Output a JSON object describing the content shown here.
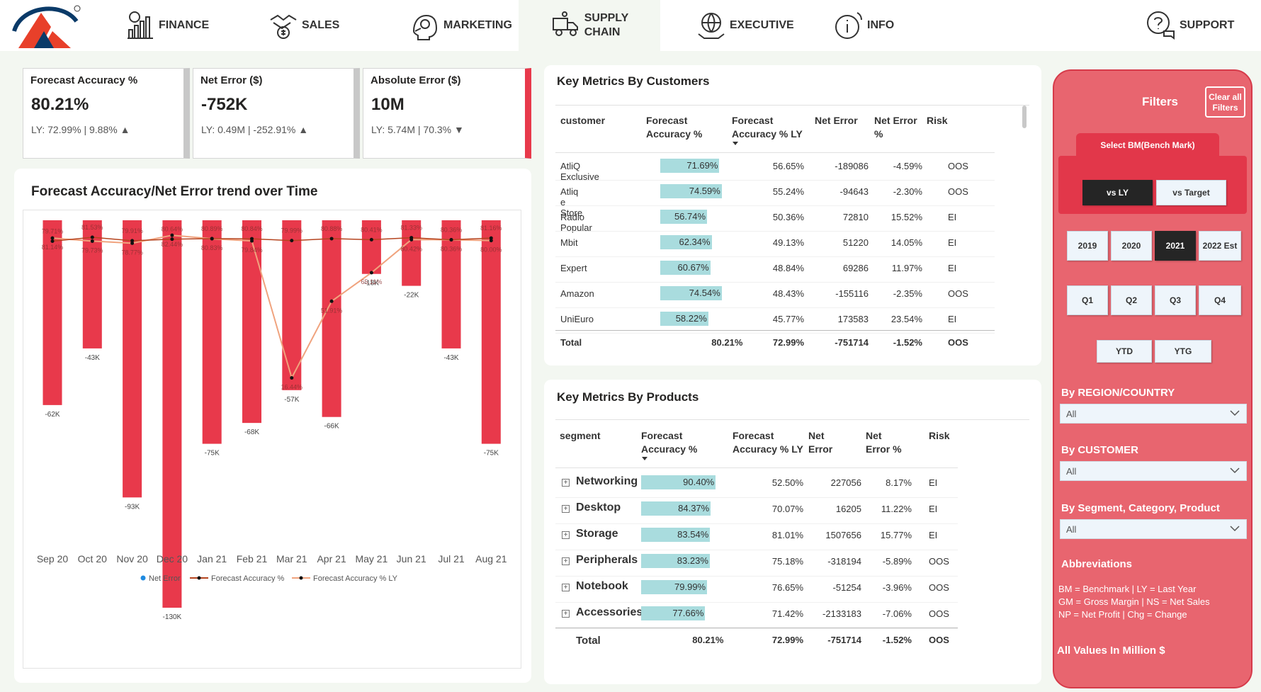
{
  "nav": {
    "items": [
      {
        "key": "finance",
        "label": "FINANCE",
        "icon": "finance-chart-icon"
      },
      {
        "key": "sales",
        "label": "SALES",
        "icon": "handshake-money-icon"
      },
      {
        "key": "marketing",
        "label": "MARKETING",
        "icon": "megaphone-head-icon"
      },
      {
        "key": "supply",
        "label_line1": "SUPPLY",
        "label_line2": "CHAIN",
        "icon": "delivery-truck-icon",
        "active": true
      },
      {
        "key": "executive",
        "label": "EXECUTIVE",
        "icon": "globe-hands-icon"
      },
      {
        "key": "info",
        "label": "INFO",
        "icon": "info-icon"
      },
      {
        "key": "support",
        "label": "SUPPORT",
        "icon": "help-chat-icon"
      }
    ],
    "brand_colors": {
      "logo_blue": "#0a3a68",
      "logo_red": "#e8402a"
    }
  },
  "kpis": [
    {
      "title": "Forecast Accuracy %",
      "value": "80.21%",
      "sub": "LY: 72.99% | 9.88% ▲"
    },
    {
      "title": "Net Error ($)",
      "value": "-752K",
      "sub": "LY: 0.49M | -252.91% ▲"
    },
    {
      "title": "Absolute Error ($)",
      "value": "10M",
      "sub": "LY: 5.74M | 70.3% ▼"
    }
  ],
  "trend": {
    "title": "Forecast Accuracy/Net Error trend over Time",
    "legend": [
      "Net Error",
      "Forecast Accuracy %",
      "Forecast Accuracy % LY"
    ],
    "colors": {
      "bar": "#e8394b",
      "fa": "#b5441f",
      "fa_ly": "#f0a37e",
      "legend_dot": "#1f8ae0"
    }
  },
  "chart_data": {
    "type": "bar",
    "categories": [
      "Sep 20",
      "Oct 20",
      "Nov 20",
      "Dec 20",
      "Jan 21",
      "Feb 21",
      "Mar 21",
      "Apr 21",
      "May 21",
      "Jun 21",
      "Jul 21",
      "Aug 21"
    ],
    "series": [
      {
        "name": "Net Error",
        "type": "bar",
        "values": [
          -62,
          -43,
          -93,
          -130,
          -75,
          -68,
          -57,
          -66,
          -18,
          -22,
          -43,
          -75
        ],
        "labels": [
          "-62K",
          "-43K",
          "-93K",
          "-130K",
          "-75K",
          "-68K",
          "-57K",
          "-66K",
          "-18K",
          "-22K",
          "-43K",
          "-75K"
        ]
      },
      {
        "name": "Forecast Accuracy %",
        "type": "line",
        "values": [
          79.71,
          81.53,
          79.91,
          80.64,
          80.89,
          80.84,
          79.99,
          80.88,
          80.41,
          81.33,
          80.36,
          81.16
        ],
        "labels": [
          "79.71%",
          "81.53%",
          "79.91%",
          "80.64%",
          "80.89%",
          "80.84%",
          "79.99%",
          "80.88%",
          "80.41%",
          "81.33%",
          "80.36%",
          "81.16%"
        ]
      },
      {
        "name": "Forecast Accuracy % LY",
        "type": "line",
        "values": [
          81.14,
          79.73,
          78.77,
          82.44,
          80.83,
          79.84,
          16.44,
          51.91,
          65.11,
          80.42,
          80.36,
          80.0
        ],
        "labels": [
          "81.14%",
          "79.73%",
          "78.77%",
          "82.44%",
          "80.83%",
          "79.84%",
          "16.44%",
          "51.91%",
          "65.11%",
          "80.42%",
          "80.36%",
          "80.00%"
        ]
      }
    ],
    "ylim_bar": [
      -130,
      0
    ],
    "grid": false,
    "legend_position": "bottom"
  },
  "customers": {
    "title": "Key Metrics By Customers",
    "headers": [
      "customer",
      "Forecast Accuracy %",
      "Forecast Accuracy % LY",
      "Net Error",
      "Net Error %",
      "Risk"
    ],
    "rows": [
      {
        "name": "AtliQ Exclusive",
        "fa": 71.69,
        "fa_text": "71.69%",
        "fa_ly": "56.65%",
        "ne": "-189086",
        "nep": "-4.59%",
        "risk": "OOS"
      },
      {
        "name": "Atliq e Store",
        "fa": 74.59,
        "fa_text": "74.59%",
        "fa_ly": "55.24%",
        "ne": "-94643",
        "nep": "-2.30%",
        "risk": "OOS"
      },
      {
        "name": "Radio Popular",
        "fa": 56.74,
        "fa_text": "56.74%",
        "fa_ly": "50.36%",
        "ne": "72810",
        "nep": "15.52%",
        "risk": "EI"
      },
      {
        "name": "Mbit",
        "fa": 62.34,
        "fa_text": "62.34%",
        "fa_ly": "49.13%",
        "ne": "51220",
        "nep": "14.05%",
        "risk": "EI"
      },
      {
        "name": "Expert",
        "fa": 60.67,
        "fa_text": "60.67%",
        "fa_ly": "48.84%",
        "ne": "69286",
        "nep": "11.97%",
        "risk": "EI"
      },
      {
        "name": "Amazon",
        "fa": 74.54,
        "fa_text": "74.54%",
        "fa_ly": "48.43%",
        "ne": "-155116",
        "nep": "-2.35%",
        "risk": "OOS"
      },
      {
        "name": "UniEuro",
        "fa": 58.22,
        "fa_text": "58.22%",
        "fa_ly": "45.77%",
        "ne": "173583",
        "nep": "23.54%",
        "risk": "EI"
      }
    ],
    "total": {
      "name": "Total",
      "fa": "80.21%",
      "fa_ly": "72.99%",
      "ne": "-751714",
      "nep": "-1.52%",
      "risk": "OOS"
    }
  },
  "products": {
    "title": "Key Metrics By Products",
    "headers": [
      "segment",
      "Forecast Accuracy %",
      "Forecast Accuracy % LY",
      "Net Error",
      "Net Error %",
      "Risk"
    ],
    "rows": [
      {
        "name": "Networking",
        "fa": 90.4,
        "fa_text": "90.40%",
        "fa_ly": "52.50%",
        "ne": "227056",
        "nep": "8.17%",
        "risk": "EI"
      },
      {
        "name": "Desktop",
        "fa": 84.37,
        "fa_text": "84.37%",
        "fa_ly": "70.07%",
        "ne": "16205",
        "nep": "11.22%",
        "risk": "EI"
      },
      {
        "name": "Storage",
        "fa": 83.54,
        "fa_text": "83.54%",
        "fa_ly": "81.01%",
        "ne": "1507656",
        "nep": "15.77%",
        "risk": "EI"
      },
      {
        "name": "Peripherals",
        "fa": 83.23,
        "fa_text": "83.23%",
        "fa_ly": "75.18%",
        "ne": "-318194",
        "nep": "-5.89%",
        "risk": "OOS"
      },
      {
        "name": "Notebook",
        "fa": 79.99,
        "fa_text": "79.99%",
        "fa_ly": "76.65%",
        "ne": "-51254",
        "nep": "-3.96%",
        "risk": "OOS"
      },
      {
        "name": "Accessories",
        "fa": 77.66,
        "fa_text": "77.66%",
        "fa_ly": "71.42%",
        "ne": "-2133183",
        "nep": "-7.06%",
        "risk": "OOS"
      }
    ],
    "total": {
      "name": "Total",
      "fa": "80.21%",
      "fa_ly": "72.99%",
      "ne": "-751714",
      "nep": "-1.52%",
      "risk": "OOS"
    }
  },
  "filters": {
    "title": "Filters",
    "clear_line1": "Clear all",
    "clear_line2": "Filters",
    "bm_label": "Select BM(Bench Mark)",
    "bm_options": [
      {
        "label": "vs LY",
        "selected": true
      },
      {
        "label": "vs Target",
        "selected": false
      }
    ],
    "years": [
      {
        "label": "2019",
        "selected": false
      },
      {
        "label": "2020",
        "selected": false
      },
      {
        "label": "2021",
        "selected": true
      },
      {
        "label": "2022 Est",
        "selected": false
      }
    ],
    "quarters": [
      "Q1",
      "Q2",
      "Q3",
      "Q4"
    ],
    "periods": [
      "YTD",
      "YTG"
    ],
    "region_label": "By REGION/COUNTRY",
    "region_value": "All",
    "customer_label": "By CUSTOMER",
    "customer_value": "All",
    "segment_label": "By Segment, Category, Product",
    "segment_value": "All",
    "abbr_title": "Abbreviations",
    "abbr_lines": [
      "BM = Benchmark | LY = Last Year",
      "GM = Gross Margin | NS = Net Sales",
      "NP =  Net Profit | Chg = Change"
    ],
    "all_values": "All Values In Million $",
    "panel_color": "#e8656f",
    "accent": "#e2374a"
  }
}
